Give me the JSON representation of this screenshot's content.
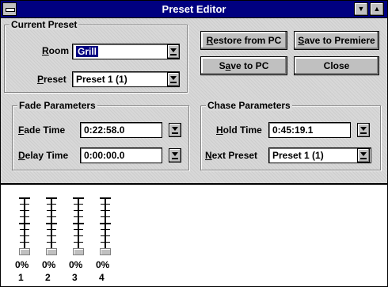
{
  "window": {
    "title": "Preset Editor"
  },
  "current_preset": {
    "title": "Current Preset",
    "room": {
      "label_prefix": "",
      "label_ul": "R",
      "label_rest": "oom",
      "value": "Grill"
    },
    "preset": {
      "label_ul": "P",
      "label_rest": "reset",
      "value": "Preset 1 (1)"
    }
  },
  "buttons": {
    "restore": {
      "ul": "R",
      "rest": "estore from PC"
    },
    "save_premiere": {
      "ul": "S",
      "rest": "ave to Premiere"
    },
    "save_pc": {
      "pre": "S",
      "ul": "a",
      "rest": "ve to PC"
    },
    "close": "Close"
  },
  "fade_parameters": {
    "title": "Fade Parameters",
    "fade_time": {
      "label_ul": "F",
      "label_rest": "ade Time",
      "value": "0:22:58.0"
    },
    "delay_time": {
      "label_ul": "D",
      "label_rest": "elay Time",
      "value": "0:00:00.0"
    }
  },
  "chase_parameters": {
    "title": "Chase Parameters",
    "hold_time": {
      "label_ul": "H",
      "label_rest": "old Time",
      "value": "0:45:19.1"
    },
    "next_preset": {
      "label_ul": "N",
      "label_rest": "ext Preset",
      "value": "Preset 1 (1)"
    }
  },
  "faders": [
    {
      "level": "0%",
      "channel": "1"
    },
    {
      "level": "0%",
      "channel": "2"
    },
    {
      "level": "0%",
      "channel": "3"
    },
    {
      "level": "0%",
      "channel": "4"
    }
  ],
  "colors": {
    "titlebar": "#000080",
    "panel": "#d8d8d8",
    "button": "#c0c0c0"
  }
}
